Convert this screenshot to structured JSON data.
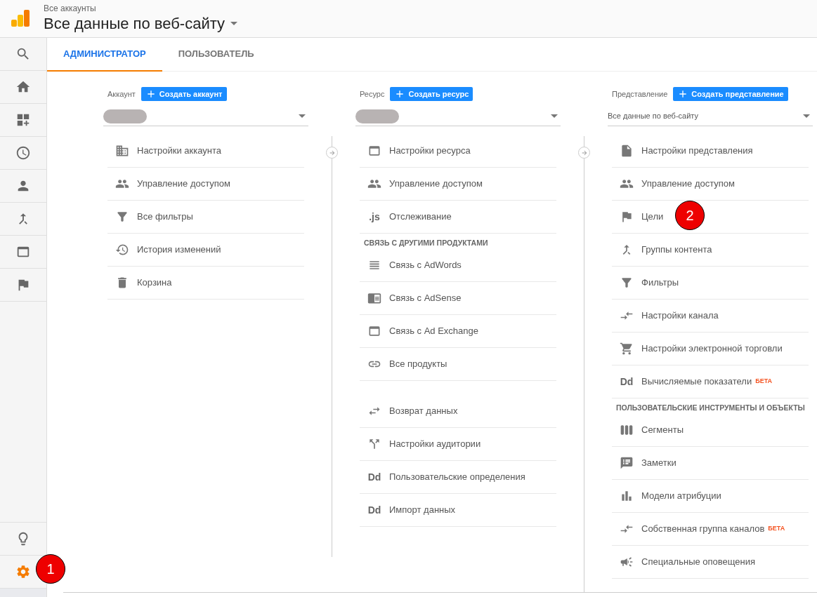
{
  "header": {
    "breadcrumb": "Все аккаунты",
    "title": "Все данные по веб-сайту"
  },
  "sidebar": {
    "top_items": [
      {
        "selected": false
      },
      {
        "selected": false
      },
      {
        "selected": false
      },
      {
        "selected": false
      },
      {
        "selected": false
      },
      {
        "selected": false
      },
      {
        "selected": false
      },
      {
        "selected": false
      }
    ],
    "bottom_items": [
      {
        "selected": false
      },
      {
        "selected": true
      }
    ]
  },
  "tabs": [
    {
      "label": "АДМИНИСТРАТОР",
      "selected": true
    },
    {
      "label": "ПОЛЬЗОВАТЕЛЬ",
      "selected": false
    }
  ],
  "columns": [
    {
      "label": "Аккаунт",
      "button": "Создать аккаунт",
      "selector": {
        "redacted": true
      },
      "groups": [
        {
          "items": [
            {
              "label": "Настройки аккаунта"
            },
            {
              "label": "Управление доступом"
            },
            {
              "label": "Все фильтры"
            },
            {
              "label": "История изменений"
            },
            {
              "label": "Корзина"
            }
          ]
        }
      ]
    },
    {
      "label": "Ресурс",
      "button": "Создать ресурс",
      "selector": {
        "redacted": true
      },
      "groups": [
        {
          "items": [
            {
              "label": "Настройки ресурса"
            },
            {
              "label": "Управление доступом"
            },
            {
              "label": "Отслеживание",
              "icon_text": ".js"
            }
          ]
        },
        {
          "heading": "СВЯЗЬ С ДРУГИМИ ПРОДУКТАМИ",
          "items": [
            {
              "label": "Связь с AdWords"
            },
            {
              "label": "Связь с AdSense"
            },
            {
              "label": "Связь с Ad Exchange"
            },
            {
              "label": "Все продукты"
            }
          ]
        },
        {
          "items": [
            {
              "label": "Возврат данных"
            },
            {
              "label": "Настройки аудитории"
            },
            {
              "label": "Пользовательские определения",
              "icon_text": "Dd"
            },
            {
              "label": "Импорт данных",
              "icon_text": "Dd"
            }
          ]
        }
      ]
    },
    {
      "label": "Представление",
      "button": "Создать представление",
      "selector": {
        "redacted": false,
        "value": "Все данные по веб-сайту"
      },
      "groups": [
        {
          "items": [
            {
              "label": "Настройки представления"
            },
            {
              "label": "Управление доступом"
            },
            {
              "label": "Цели"
            },
            {
              "label": "Группы контента"
            },
            {
              "label": "Фильтры"
            },
            {
              "label": "Настройки канала"
            },
            {
              "label": "Настройки электронной торговли"
            },
            {
              "label": "Вычисляемые показатели",
              "icon_text": "Dd",
              "badge": "БЕТА"
            }
          ]
        },
        {
          "heading": "ПОЛЬЗОВАТЕЛЬСКИЕ ИНСТРУМЕНТЫ И ОБЪЕКТЫ",
          "items": [
            {
              "label": "Сегменты"
            },
            {
              "label": "Заметки"
            },
            {
              "label": "Модели атрибуции"
            },
            {
              "label": "Собственная группа каналов",
              "badge": "БЕТА"
            },
            {
              "label": "Специальные оповещения"
            }
          ]
        }
      ]
    }
  ],
  "annotations": [
    {
      "number": "1"
    },
    {
      "number": "2"
    }
  ]
}
